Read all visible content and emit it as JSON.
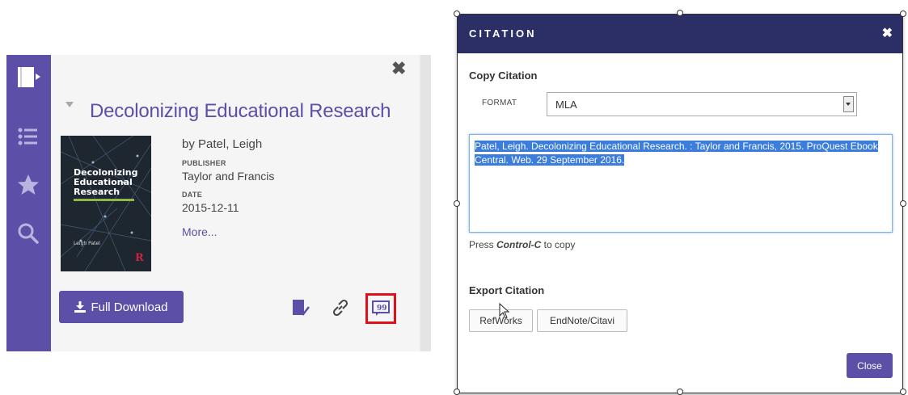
{
  "record": {
    "title": "Decolonizing Educational Research",
    "author": "by Patel, Leigh",
    "publisher_label": "PUBLISHER",
    "publisher": "Taylor and Francis",
    "date_label": "DATE",
    "date": "2015-12-11",
    "more_link": "More...",
    "full_download_label": "Full Download",
    "close_symbol": "✖",
    "cover": {
      "title_line1": "Decolonizing",
      "title_line2": "Educational",
      "title_line3": "Research",
      "author": "Leigh Patel",
      "publisher_mark": "R"
    }
  },
  "sidebar": {
    "icons": [
      "book-icon",
      "list-icon",
      "star-icon",
      "search-icon"
    ]
  },
  "actions": {
    "icons": [
      "save-icon",
      "link-icon",
      "cite-icon"
    ]
  },
  "dialog": {
    "title": "CITATION",
    "close_symbol": "✖",
    "copy_heading": "Copy Citation",
    "format_label": "FORMAT",
    "format_value": "MLA",
    "citation_text": "Patel, Leigh. Decolonizing Educational Research. : Taylor and Francis, 2015. ProQuest Ebook Central. Web. 29 September 2016.",
    "copy_hint_prefix": "Press ",
    "copy_hint_key": "Control-C",
    "copy_hint_suffix": " to copy",
    "export_heading": "Export Citation",
    "export_buttons": [
      "RefWorks",
      "EndNote/Citavi"
    ],
    "close_button": "Close"
  },
  "colors": {
    "brand_purple": "#5c4fa8",
    "dialog_header": "#2b2f66",
    "highlight_red": "#e0101a",
    "selection_blue": "#3b7ddd"
  }
}
